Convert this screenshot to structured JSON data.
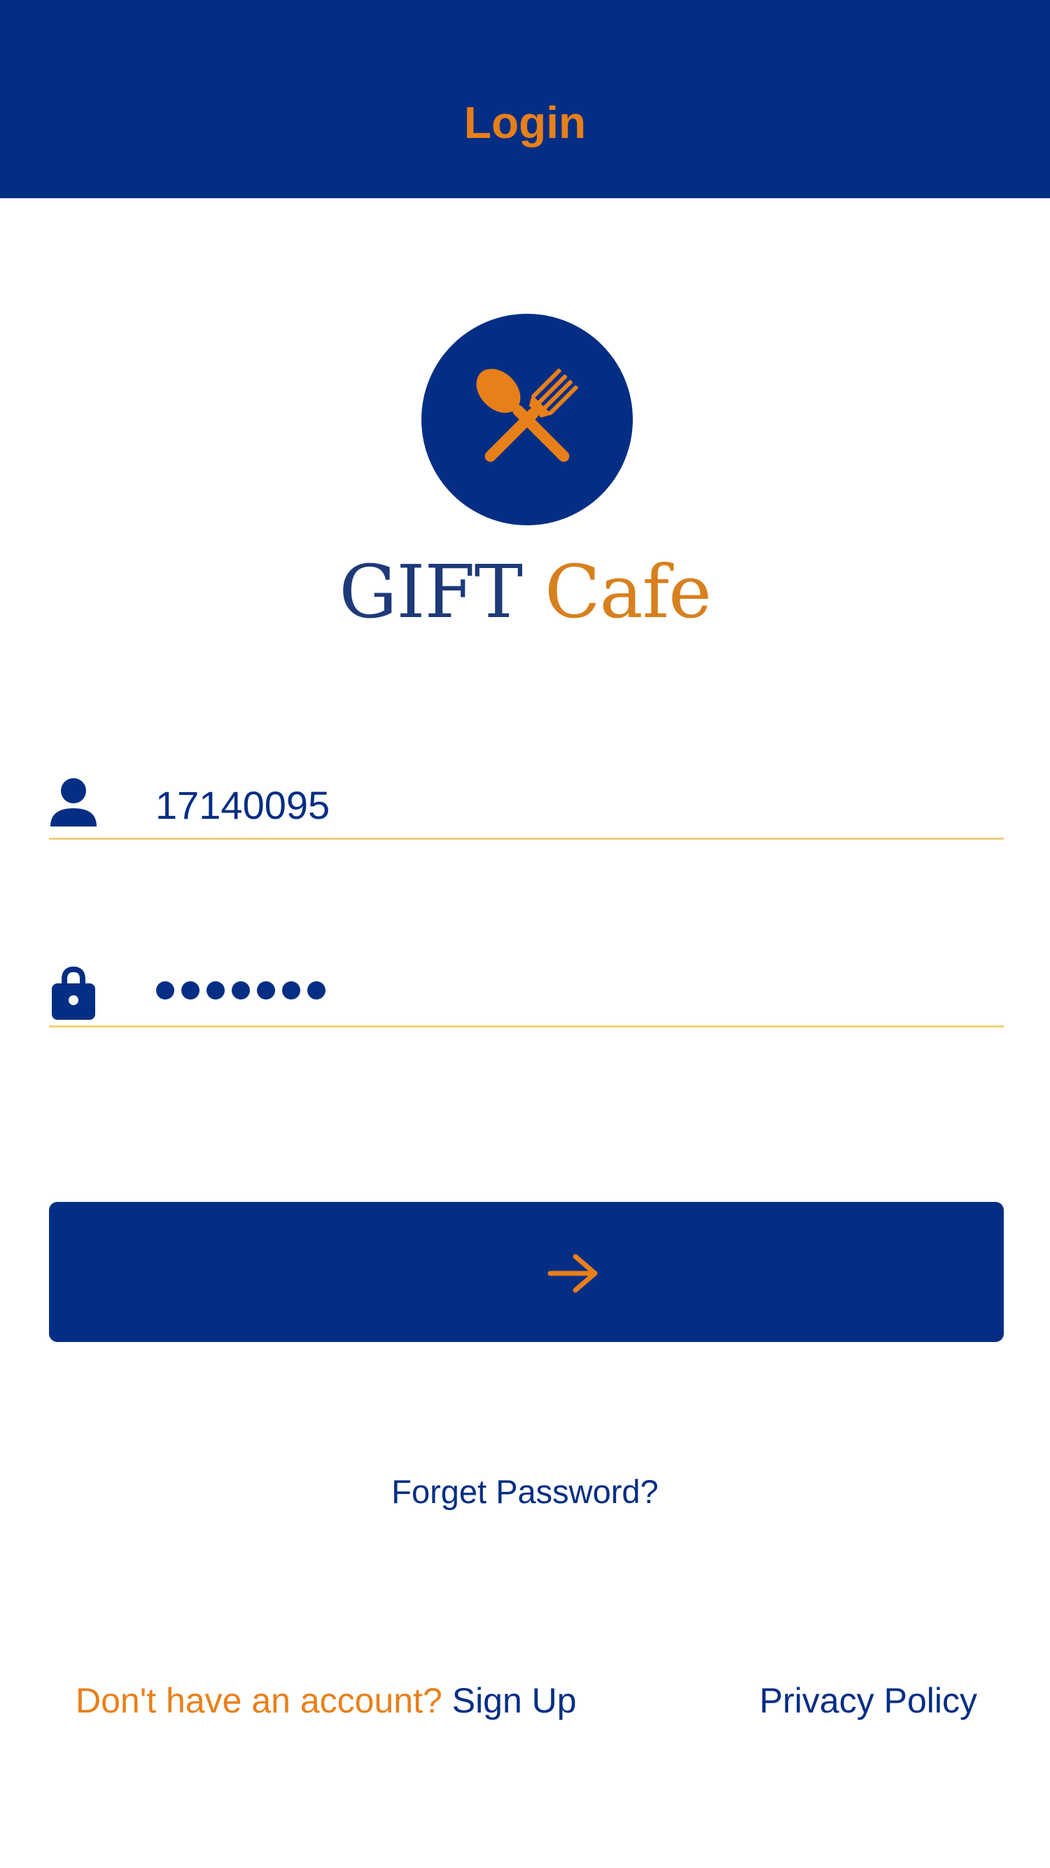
{
  "app_bar": {
    "title": "Login"
  },
  "logo": {
    "icon": "spoon-fork-crossed-icon",
    "brand_part_1": "GIFT",
    "brand_part_2": "Cafe"
  },
  "form": {
    "username": {
      "icon": "person-icon",
      "value": "17140095"
    },
    "password": {
      "icon": "lock-icon",
      "masked_length": 7
    },
    "submit": {
      "icon": "arrow-right-icon"
    }
  },
  "links": {
    "forgot_password": "Forget Password?",
    "no_account_prompt": "Don't have an account?",
    "sign_up": "Sign Up",
    "privacy_policy": "Privacy Policy"
  },
  "colors": {
    "primary": "#042e84",
    "accent": "#e8801a",
    "underline": "#f0cf78",
    "background": "#ffffff"
  }
}
